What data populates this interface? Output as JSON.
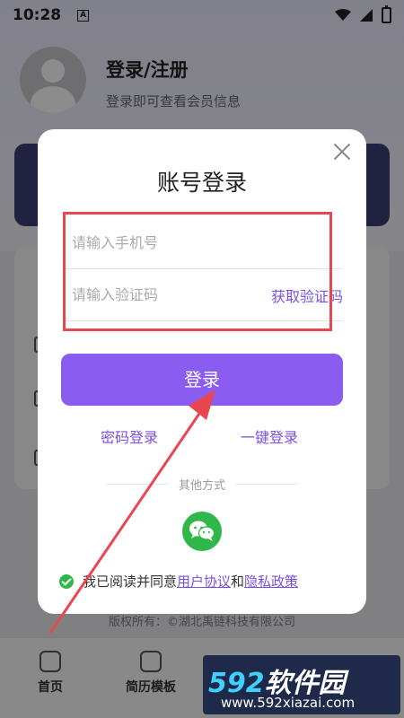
{
  "status_bar": {
    "time": "10:28",
    "notification_letter": "A"
  },
  "profile": {
    "title": "登录/注册",
    "subtitle": "登录即可查看会员信息"
  },
  "footer": {
    "copyright": "版权所有：©湖北禹链科技有限公司"
  },
  "tabbar": {
    "items": [
      {
        "label": "首页"
      },
      {
        "label": "简历模板"
      }
    ]
  },
  "dialog": {
    "title": "账号登录",
    "phone_placeholder": "请输入手机号",
    "code_placeholder": "请输入验证码",
    "get_code_label": "获取验证码",
    "login_label": "登录",
    "password_login_label": "密码登录",
    "one_click_login_label": "一键登录",
    "other_methods_label": "其他方式",
    "agree_prefix": "我已阅读并同意",
    "user_agreement": "用户协议",
    "and": "和",
    "privacy_policy": "隐私政策"
  },
  "watermark": {
    "main_num": "592",
    "main_text": "软件园",
    "url": "www.592xiazai.com"
  },
  "colors": {
    "accent": "#8a5cf0",
    "link": "#7b4fe0",
    "wechat": "#2fb74a",
    "highlight": "#e8474f"
  }
}
